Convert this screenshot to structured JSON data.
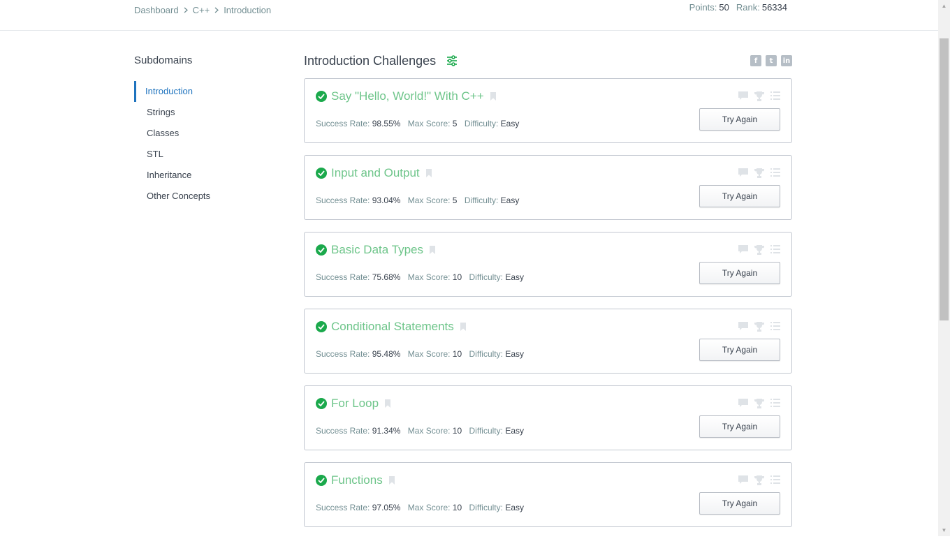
{
  "breadcrumb": [
    "Dashboard",
    "C++",
    "Introduction"
  ],
  "stats": {
    "points_label": "Points:",
    "points": "50",
    "rank_label": "Rank:",
    "rank": "56334"
  },
  "sidebar": {
    "title": "Subdomains",
    "items": [
      "Introduction",
      "Strings",
      "Classes",
      "STL",
      "Inheritance",
      "Other Concepts"
    ],
    "active": "Introduction"
  },
  "main": {
    "title": "Introduction Challenges"
  },
  "labels": {
    "success_rate": "Success Rate:",
    "max_score": "Max Score:",
    "difficulty": "Difficulty:",
    "button": "Try Again"
  },
  "challenges": [
    {
      "name": "Say \"Hello, World!\" With C++",
      "success_rate": "98.55%",
      "max_score": "5",
      "difficulty": "Easy"
    },
    {
      "name": "Input and Output",
      "success_rate": "93.04%",
      "max_score": "5",
      "difficulty": "Easy"
    },
    {
      "name": "Basic Data Types",
      "success_rate": "75.68%",
      "max_score": "10",
      "difficulty": "Easy"
    },
    {
      "name": "Conditional Statements",
      "success_rate": "95.48%",
      "max_score": "10",
      "difficulty": "Easy"
    },
    {
      "name": "For Loop",
      "success_rate": "91.34%",
      "max_score": "10",
      "difficulty": "Easy"
    },
    {
      "name": "Functions",
      "success_rate": "97.05%",
      "max_score": "10",
      "difficulty": "Easy"
    }
  ],
  "icons": {
    "share": [
      "facebook-icon",
      "twitter-icon",
      "linkedin-icon"
    ],
    "card": [
      "discussion-icon",
      "leaderboard-icon",
      "editorial-icon"
    ]
  },
  "colors": {
    "accent": "#1e73be",
    "solved_green": "#1ba94c",
    "challenge_title": "#6ec58a",
    "filter_icon": "#1ba94c"
  }
}
